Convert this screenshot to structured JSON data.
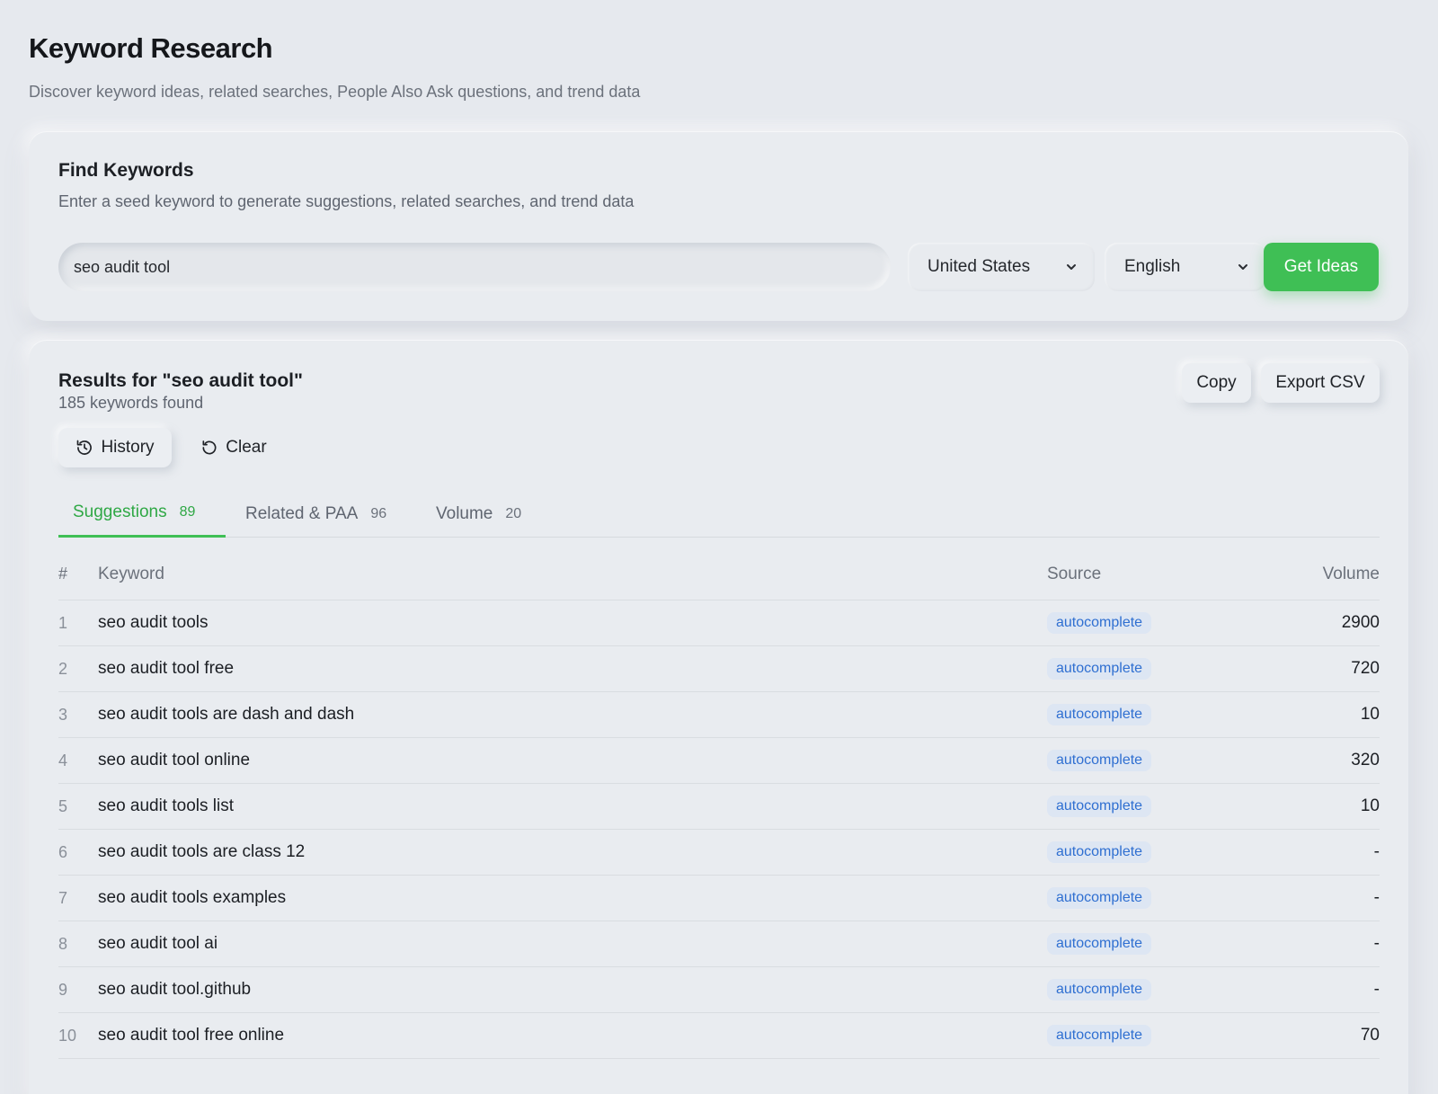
{
  "page": {
    "title": "Keyword Research",
    "subtitle": "Discover keyword ideas, related searches, People Also Ask questions, and trend data"
  },
  "find": {
    "title": "Find Keywords",
    "subtitle": "Enter a seed keyword to generate suggestions, related searches, and trend data",
    "input_value": "seo audit tool",
    "country": "United States",
    "language": "English",
    "submit_label": "Get Ideas"
  },
  "results": {
    "title": "Results for \"seo audit tool\"",
    "count_text": "185 keywords found",
    "copy_label": "Copy",
    "export_label": "Export CSV",
    "history_label": "History",
    "clear_label": "Clear",
    "tabs": [
      {
        "label": "Suggestions",
        "count": "89",
        "active": true
      },
      {
        "label": "Related & PAA",
        "count": "96",
        "active": false
      },
      {
        "label": "Volume",
        "count": "20",
        "active": false
      }
    ],
    "columns": {
      "num": "#",
      "keyword": "Keyword",
      "source": "Source",
      "volume": "Volume"
    },
    "rows": [
      {
        "num": "1",
        "keyword": "seo audit tools",
        "source": "autocomplete",
        "volume": "2900"
      },
      {
        "num": "2",
        "keyword": "seo audit tool free",
        "source": "autocomplete",
        "volume": "720"
      },
      {
        "num": "3",
        "keyword": "seo audit tools are dash and dash",
        "source": "autocomplete",
        "volume": "10"
      },
      {
        "num": "4",
        "keyword": "seo audit tool online",
        "source": "autocomplete",
        "volume": "320"
      },
      {
        "num": "5",
        "keyword": "seo audit tools list",
        "source": "autocomplete",
        "volume": "10"
      },
      {
        "num": "6",
        "keyword": "seo audit tools are class 12",
        "source": "autocomplete",
        "volume": "-"
      },
      {
        "num": "7",
        "keyword": "seo audit tools examples",
        "source": "autocomplete",
        "volume": "-"
      },
      {
        "num": "8",
        "keyword": "seo audit tool ai",
        "source": "autocomplete",
        "volume": "-"
      },
      {
        "num": "9",
        "keyword": "seo audit tool.github",
        "source": "autocomplete",
        "volume": "-"
      },
      {
        "num": "10",
        "keyword": "seo audit tool free online",
        "source": "autocomplete",
        "volume": "70"
      }
    ]
  },
  "colors": {
    "accent": "#3fbf55",
    "badge_text": "#2f6fd1",
    "badge_bg": "#dde6f3",
    "background": "#e6e9ee"
  },
  "icons": {
    "history": "history-icon",
    "clear": "refresh-icon",
    "dropdown": "chevron-down-icon"
  }
}
